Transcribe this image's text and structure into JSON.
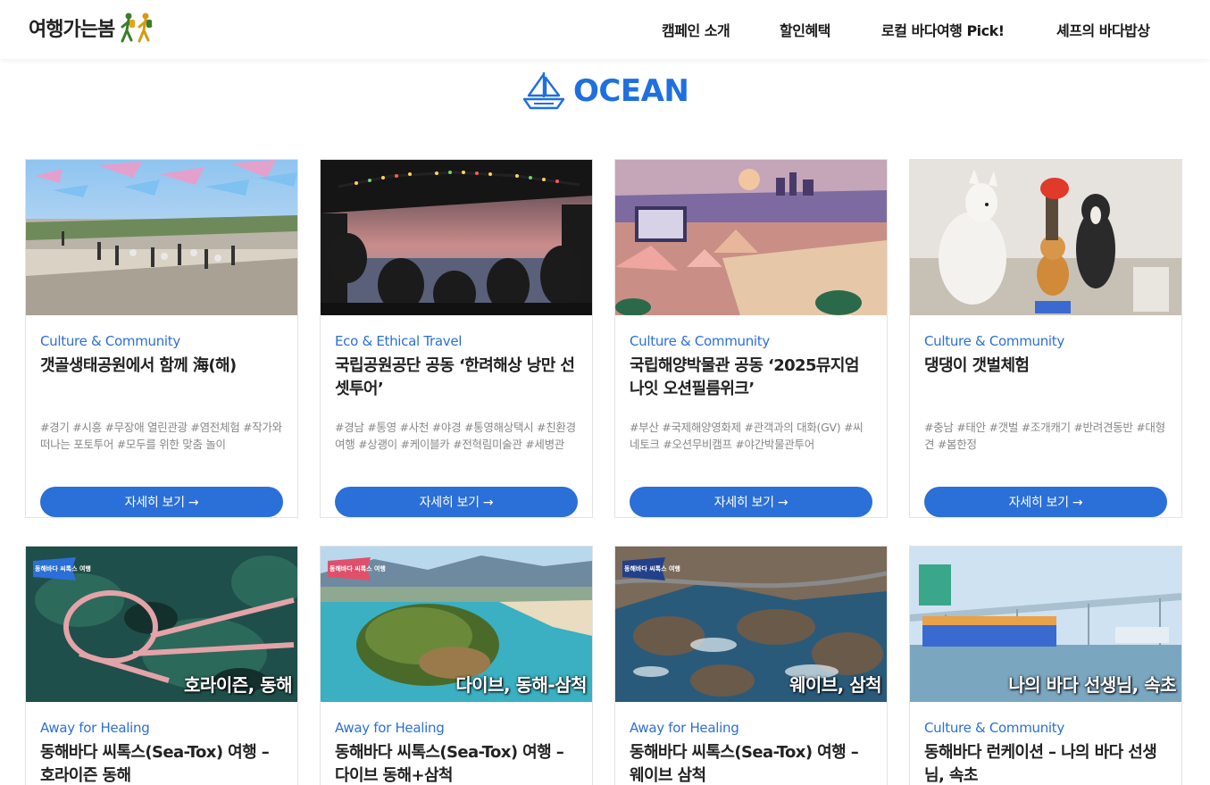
{
  "header": {
    "logo_text": "여행가는봄",
    "nav": [
      "캠페인 소개",
      "할인혜택",
      "로컬 바다여행 Pick!",
      "셰프의 바다밥상"
    ]
  },
  "section": {
    "title": "OCEAN",
    "icon": "sailboat-icon"
  },
  "button_label": "자세히 보기 →",
  "cards": [
    {
      "category": "Culture & Community",
      "title": "갯골생태공원에서 함께 海(해)",
      "tags": "#경기 #시흥 #무장애 열린관광 #염전체험 #작가와 떠나는 포토투어 #모두를 위한 맞춤 놀이"
    },
    {
      "category": "Eco & Ethical Travel",
      "title": "국립공원공단 공동 ‘한려해상 낭만 선셋투어’",
      "tags": "#경남 #통영 #사천 #야경 #통영해상택시 #친환경여행 #상괭이 #케이블카 #전혁림미술관 #세병관"
    },
    {
      "category": "Culture & Community",
      "title": "국립해양박물관 공동 ‘2025뮤지엄나잇 오션필름위크’",
      "tags": "#부산 #국제해양영화제 #관객과의 대화(GV) #씨네토크 #오션무비캠프 #야간박물관투어"
    },
    {
      "category": "Culture & Community",
      "title": "댕댕이 갯벌체험",
      "tags": "#충남 #태안 #갯벌 #조개캐기 #반려견동반 #대형견 #봄한정"
    },
    {
      "category": "Away for Healing",
      "title": "동해바다 씨톡스(Sea-Tox) 여행 – 호라이즌 동해",
      "caption": "호라이즌, 동해",
      "badge": "동해바다 씨톡스 여행"
    },
    {
      "category": "Away for Healing",
      "title": "동해바다 씨톡스(Sea-Tox) 여행 – 다이브 동해+삼척",
      "caption": "다이브, 동해-삼척",
      "badge": "동해바다 씨톡스 여행"
    },
    {
      "category": "Away for Healing",
      "title": "동해바다 씨톡스(Sea-Tox) 여행 – 웨이브 삼척",
      "caption": "웨이브, 삼척",
      "badge": "동해바다 씨톡스 여행"
    },
    {
      "category": "Culture & Community",
      "title": "동해바다 런케이션 – 나의 바다 선생님, 속초",
      "caption": "나의 바다 선생님, 속초",
      "badge": "나의 바다 선생님 속초"
    }
  ],
  "image_subjects": [
    "photo-salt-field-flags",
    "photo-sunset-boat-tour",
    "illustration-museum-film-camp",
    "photo-dogs-mudflat",
    "photo-bridge-sea-aerial",
    "photo-island-coast-aerial",
    "photo-rocky-coast-walkway",
    "photo-harbor-bridge-boat"
  ]
}
